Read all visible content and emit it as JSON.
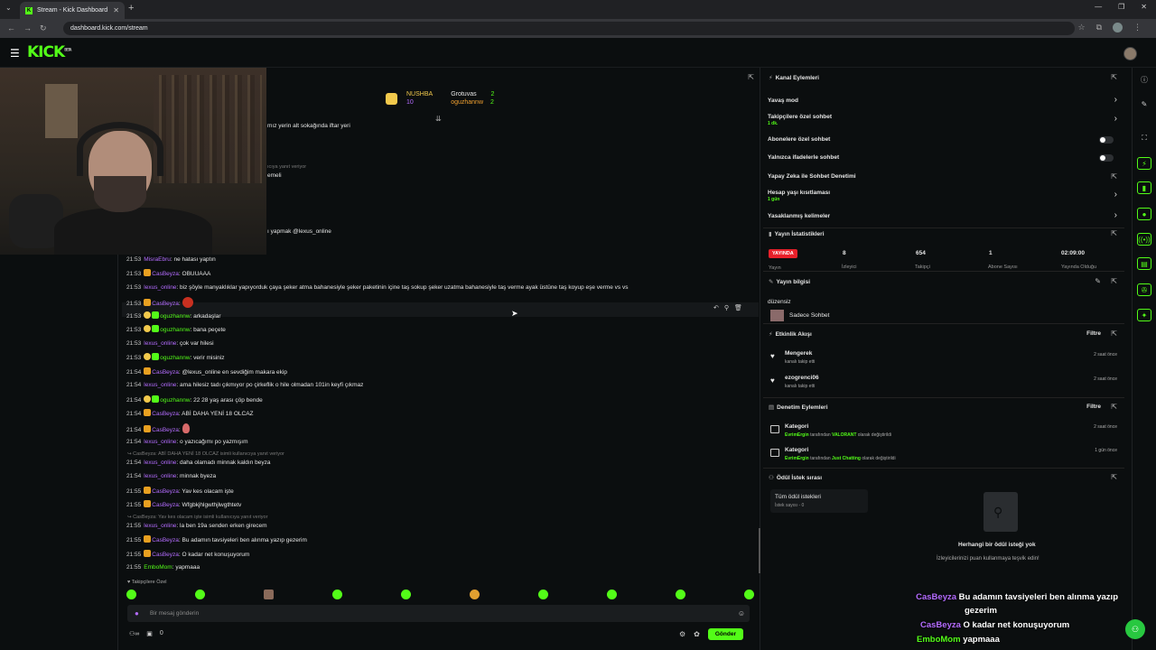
{
  "browser": {
    "tab_title": "Stream - Kick Dashboard",
    "tab_favicon": "K",
    "url": "dashboard.kick.com/stream"
  },
  "topbar": {
    "logo": "KICK",
    "logo_sup": "BETA"
  },
  "gifters": [
    {
      "name": "NUSHBA",
      "count": "10"
    },
    {
      "name": "Grotuvas",
      "count": "2"
    },
    {
      "name": "oguzhannw",
      "count": "2"
    }
  ],
  "chat": {
    "partial_lines": [
      "mız yerin alt sokağında iftar yeri",
      "ıcıya yanıt veriyor",
      "emeli",
      "ı yapmak @lexus_online"
    ],
    "messages": [
      {
        "time": "21:53",
        "user": "MisraEbru",
        "text": ": ne hatası yaptın"
      },
      {
        "time": "21:53",
        "user": "CasBeyza",
        "text": ": OBUUAAA"
      },
      {
        "time": "21:53",
        "user": "lexus_online",
        "text": ": biz şöyle manyaklıklar yapıyorduk çaya şeker atma bahanesiyle şeker paketinin içine taş sokup şeker uzatma bahanesiyle taş verme ayak üstüne taş koyup eşe verme vs vs"
      },
      {
        "time": "21:53",
        "user": "CasBeyza",
        "text": ":"
      },
      {
        "time": "21:53",
        "user": "oguzhannw",
        "text": ": arkadaşlar"
      },
      {
        "time": "21:53",
        "user": "oguzhannw",
        "text": ": bana peçete"
      },
      {
        "time": "21:53",
        "user": "lexus_online",
        "text": ": çok var hilesi"
      },
      {
        "time": "21:53",
        "user": "oguzhannw",
        "text": ": verir misiniz"
      },
      {
        "time": "21:54",
        "user": "CasBeyza",
        "text": ": @lexus_online en sevdiğim makara ekip"
      },
      {
        "time": "21:54",
        "user": "lexus_online",
        "text": ": ama hilesiz tadı çıkmıyor po çirkeflik o hile olmadan 101in keyfi çıkmaz"
      },
      {
        "time": "21:54",
        "user": "oguzhannw",
        "text": ": 22 28 yaş arası çöp bende"
      },
      {
        "time": "21:54",
        "user": "CasBeyza",
        "text": ": ABİ DAHA YENİ 18 OLCAZ"
      },
      {
        "time": "21:54",
        "user": "CasBeyza",
        "text": ":"
      },
      {
        "time": "21:54",
        "user": "lexus_online",
        "text": ": o yazıcağımı po yazmışım"
      },
      {
        "reply": "↪ CasBeyza: ABİ DAHA YENİ 18 OLCAZ isimli kullanıcıya yanıt veriyor"
      },
      {
        "time": "21:54",
        "user": "lexus_online",
        "text": ": daha olamadı minnak kaldın beyza"
      },
      {
        "time": "21:54",
        "user": "lexus_online",
        "text": ": minnak byeza"
      },
      {
        "time": "21:55",
        "user": "CasBeyza",
        "text": ": Yav kes olacam işte"
      },
      {
        "time": "21:55",
        "user": "CasBeyza",
        "text": ": Wfgbkjhlgwthjlwgthtetv"
      },
      {
        "reply": "↪ CasBeyza: Yav kes olacam işte isimli kullanıcıya yanıt veriyor"
      },
      {
        "time": "21:55",
        "user": "lexus_online",
        "text": ": la ben 19a senden erken girecem"
      },
      {
        "time": "21:55",
        "user": "CasBeyza",
        "text": ": Bu adamın tavsiyeleri ben alınma yazıp gezerim"
      },
      {
        "time": "21:55",
        "user": "CasBeyza",
        "text": ": O kadar net konuşuyorum"
      },
      {
        "time": "21:55",
        "user": "EmboMom",
        "text": ": yapmaaa"
      }
    ],
    "followers_only": "Takipçilere Özel",
    "input_placeholder": "Bir mesaj gönderin",
    "count": "0",
    "send_label": "Gönder"
  },
  "channel_actions": {
    "title": "Kanal Eylemleri",
    "items": [
      {
        "label": "Yavaş mod"
      },
      {
        "label": "Takipçilere özel sohbet",
        "sub": "1 dk."
      },
      {
        "label": "Abonelere özel sohbet"
      },
      {
        "label": "Yalnızca ifadelerle sohbet"
      },
      {
        "label": "Yapay Zeka ile Sohbet Denetimi"
      },
      {
        "label": "Hesap yaşı kısıtlaması",
        "sub": "1 gün"
      },
      {
        "label": "Yasaklanmış kelimeler"
      }
    ]
  },
  "stream_stats": {
    "title": "Yayın İstatistikleri",
    "live": "YAYINDA",
    "viewers": "8",
    "viewers_label": "İzleyici",
    "followers": "654",
    "followers_label": "Takipçi",
    "subs": "1",
    "subs_label": "Abone Sayısı",
    "duration": "02:09:00",
    "duration_label": "Yayında Olduğu",
    "left_label": "Yayın"
  },
  "stream_info": {
    "title": "Yayın bilgisi",
    "stream_title": "düzensiz",
    "category": "Sadece Sohbet"
  },
  "activity": {
    "title": "Etkinlik Akışı",
    "filter": "Filtre",
    "events": [
      {
        "name": "Mengerek",
        "sub": "kanalı takip etti",
        "time": "2 saat önce"
      },
      {
        "name": "ezogrenci06",
        "sub": "kanalı takip etti",
        "time": "2 saat önce"
      }
    ]
  },
  "mod_actions": {
    "title": "Denetim Eylemleri",
    "filter": "Filtre",
    "items": [
      {
        "name": "Kategori",
        "user": "EvrimErgin",
        "mid": " tarafından ",
        "value": "VALORANT",
        "tail": " olarak değiştirildi",
        "time": "2 saat önce"
      },
      {
        "name": "Kategori",
        "user": "EvrimErgin",
        "mid": " tarafından ",
        "value": "Just Chatting",
        "tail": " olarak değiştirildi",
        "time": "1 gün önce"
      }
    ]
  },
  "rewards": {
    "title": "Ödül İstek sırası",
    "tab_title": "Tüm ödül istekleri",
    "tab_sub": "İstek sayısı - 0",
    "empty_title": "Herhangi bir ödül isteği yok",
    "empty_sub": "İzleyicilerinizi puan kullanmaya teşvik edin!"
  },
  "overlay_chat": [
    {
      "user": "CasBeyza",
      "text": "Bu adamın tavsiyeleri ben alınma yazıp"
    },
    {
      "user": "",
      "text": "gezerim"
    },
    {
      "user": "CasBeyza",
      "text": "O kadar net konuşuyorum"
    },
    {
      "user": "EmboMom",
      "text": "yapmaaa"
    }
  ],
  "colors": {
    "brand": "#53fc18",
    "live": "#e8202a",
    "username_purple": "#b46cff",
    "username_yellow": "#f2c94c"
  }
}
